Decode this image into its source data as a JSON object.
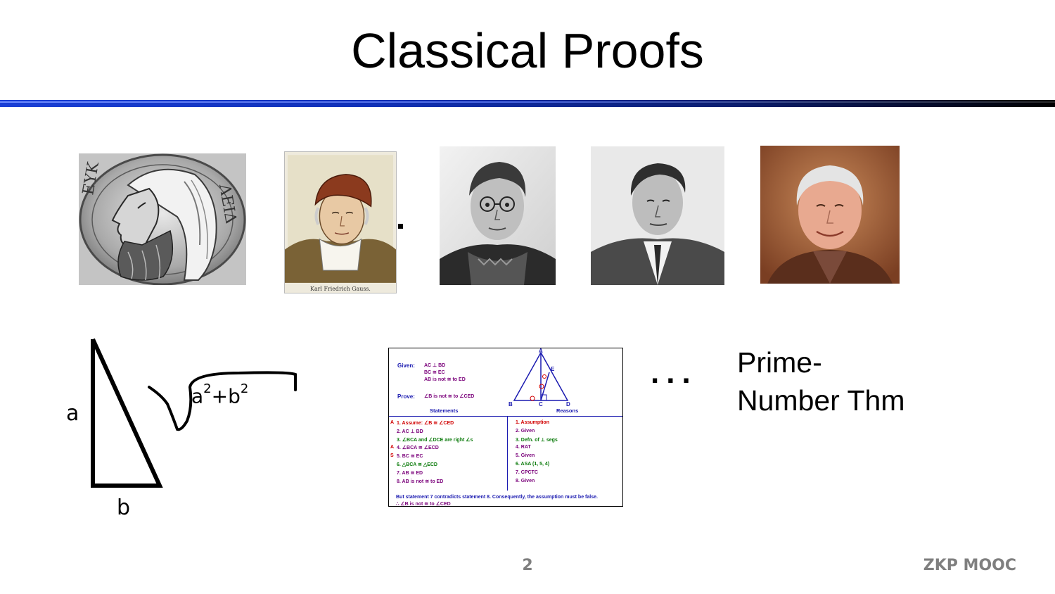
{
  "slide": {
    "title": "Classical Proofs",
    "page_number": "2",
    "footer": "ZKP MOOC"
  },
  "portraits": [
    {
      "name": "euclid-coin-portrait",
      "coin_letters_left": "ΕΥΚ",
      "coin_letters_right": "ΛΕΙΔ"
    },
    {
      "name": "gauss-engraving-portrait",
      "caption": "Karl Friedrich Gauss."
    },
    {
      "name": "noether-photo-portrait"
    },
    {
      "name": "turing-photo-portrait"
    },
    {
      "name": "modern-mathematician-photo-portrait"
    }
  ],
  "pythagoras": {
    "side_a": "a",
    "side_b": "b",
    "formula_base_a": "a",
    "formula_exp_a": "2",
    "formula_plus": "+",
    "formula_base_b": "b",
    "formula_exp_b": "2"
  },
  "two_column_proof": {
    "vertices": {
      "top": "A",
      "left": "B",
      "mid": "C",
      "right": "D",
      "side": "E"
    },
    "given_label": "Given:",
    "given_lines": [
      "AC ⊥ BD",
      "BC ≅ EC",
      "AB is not ≅ to ED"
    ],
    "prove_label": "Prove:",
    "prove_line": "∠B is not ≅ to ∠CED",
    "statements_header": "Statements",
    "reasons_header": "Reasons",
    "steps": [
      {
        "marker": "A",
        "statement": "1.  Assume:  ∠B ≅ ∠CED",
        "reason": "1.  Assumption",
        "color": "#d10000"
      },
      {
        "marker": "",
        "statement": "2.  AC ⊥ BD",
        "reason": "2.  Given",
        "color": "#7a007a"
      },
      {
        "marker": "",
        "statement": "3.  ∠BCA and ∠DCE are right ∠s",
        "reason": "3.  Defn. of ⊥ segs",
        "color": "#0a7a0a"
      },
      {
        "marker": "A",
        "statement": "4.  ∠BCA ≅ ∠ECD",
        "reason": "4.  RAT",
        "color": "#7a007a"
      },
      {
        "marker": "S",
        "statement": "5.  BC ≅ EC",
        "reason": "5.  Given",
        "color": "#7a007a"
      },
      {
        "marker": "",
        "statement": "6.  △BCA ≅ △ECD",
        "reason": "6.  ASA (1, 5, 4)",
        "color": "#0a7a0a"
      },
      {
        "marker": "",
        "statement": "7.  AB ≅ ED",
        "reason": "7.  CPCTC",
        "color": "#7a007a"
      },
      {
        "marker": "",
        "statement": "8.  AB is not ≅ to ED",
        "reason": "8.  Given",
        "color": "#7a007a"
      }
    ],
    "conclusion": "But statement 7 contradicts statement 8.  Consequently, the assumption must be false.",
    "conclusion_line2": "∴ ∠B is not ≅ to ∠CED"
  },
  "ellipsis": "...",
  "prime_theorem": {
    "line1": "Prime-",
    "line2": "Number Thm"
  }
}
